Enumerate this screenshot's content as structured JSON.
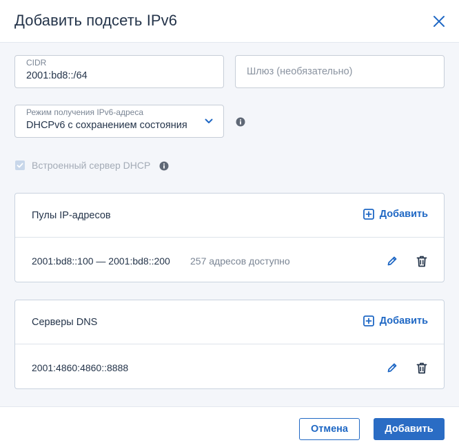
{
  "dialog": {
    "title": "Добавить подсеть IPv6"
  },
  "form": {
    "cidr": {
      "label": "CIDR",
      "value": "2001:bd8::/64"
    },
    "gateway": {
      "placeholder": "Шлюз (необязательно)"
    },
    "mode": {
      "label": "Режим получения IPv6-адреса",
      "value": "DHCPv6 с сохранением состояния"
    },
    "dhcp_server": {
      "label": "Встроенный сервер DHCP",
      "checked": true,
      "disabled": true
    }
  },
  "pools": {
    "title": "Пулы IP-адресов",
    "add_label": "Добавить",
    "items": [
      {
        "range": "2001:bd8::100 — 2001:bd8::200",
        "available": "257 адресов доступно"
      }
    ]
  },
  "dns": {
    "title": "Серверы DNS",
    "add_label": "Добавить",
    "items": [
      {
        "address": "2001:4860:4860::8888"
      }
    ]
  },
  "footer": {
    "cancel_label": "Отмена",
    "submit_label": "Добавить"
  },
  "colors": {
    "accent": "#1e67c4",
    "text": "#24344a",
    "muted": "#7a8594",
    "background": "#f4f6fa"
  },
  "icons": [
    "close-icon",
    "chevron-down-icon",
    "info-icon",
    "check-icon",
    "plus-square-icon",
    "pencil-icon",
    "trash-icon"
  ]
}
